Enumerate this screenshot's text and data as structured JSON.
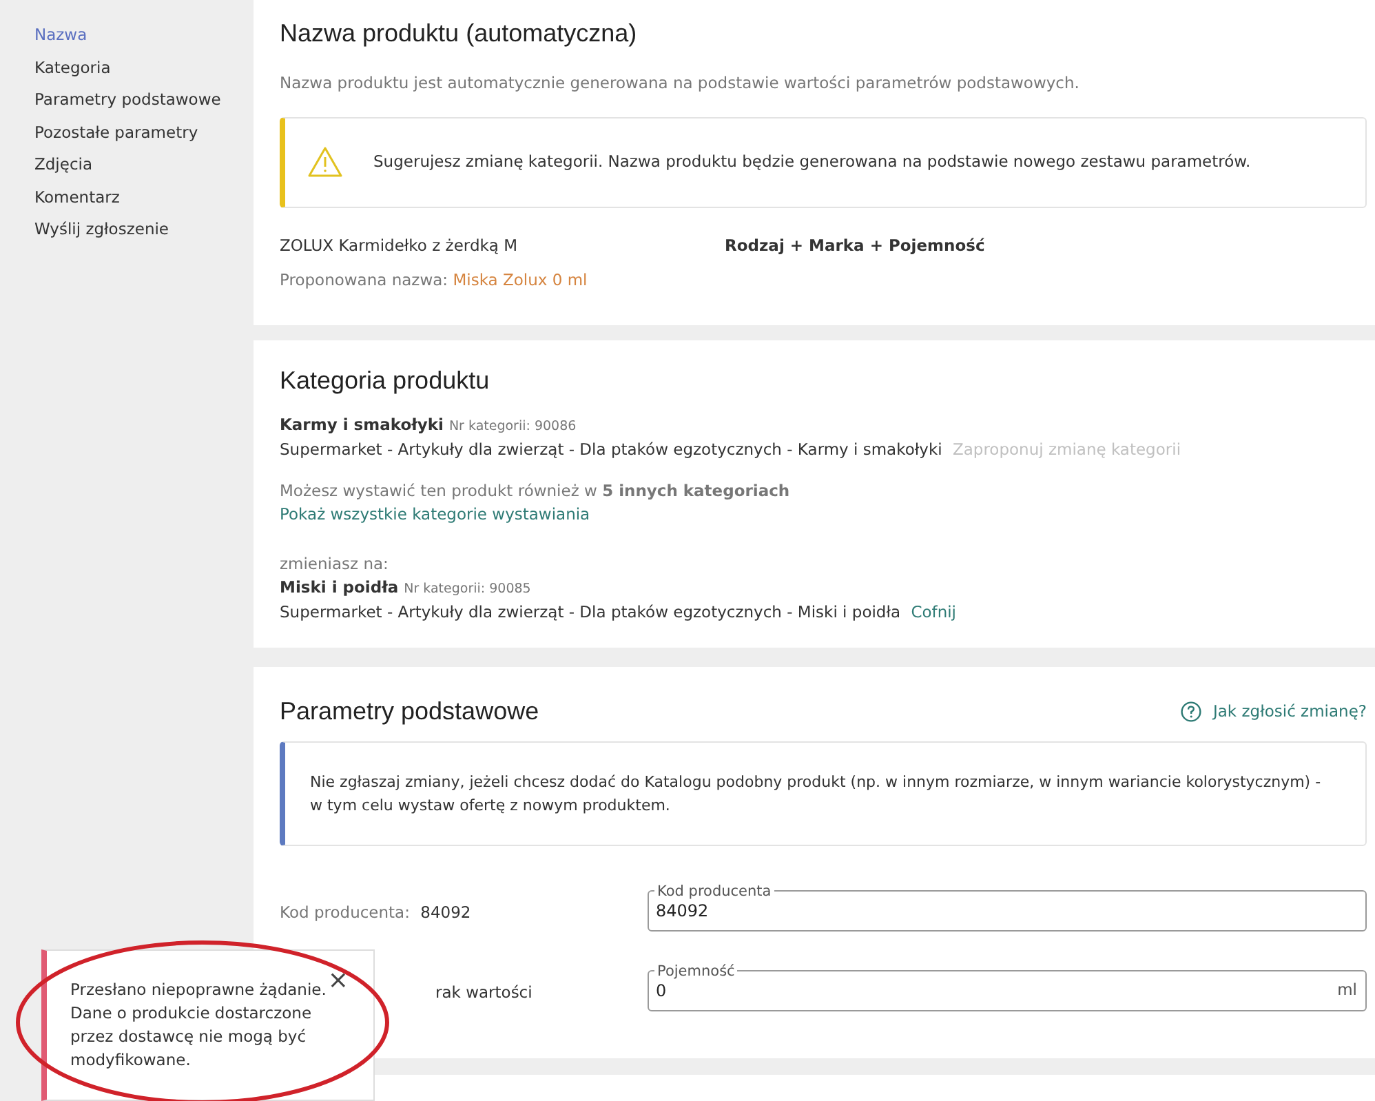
{
  "sidebar": {
    "items": [
      {
        "label": "Nazwa",
        "selected": true
      },
      {
        "label": "Kategoria",
        "selected": false
      },
      {
        "label": "Parametry podstawowe",
        "selected": false
      },
      {
        "label": "Pozostałe parametry",
        "selected": false
      },
      {
        "label": "Zdjęcia",
        "selected": false
      },
      {
        "label": "Komentarz",
        "selected": false
      },
      {
        "label": "Wyślij zgłoszenie",
        "selected": false
      }
    ]
  },
  "name_section": {
    "title": "Nazwa produktu (automatyczna)",
    "description": "Nazwa produktu jest automatycznie generowana na podstawie wartości parametrów podstawowych.",
    "alert": "Sugerujesz zmianę kategorii. Nazwa produktu będzie generowana na podstawie nowego zestawu parametrów.",
    "current_name": "ZOLUX Karmidełko z żerdką M",
    "formula": "Rodzaj + Marka + Pojemność",
    "proposed_label": "Proponowana nazwa:",
    "proposed_value": "Miska Zolux 0 ml"
  },
  "category_section": {
    "title": "Kategoria produktu",
    "current": {
      "name": "Karmy i smakołyki",
      "number": "Nr kategorii: 90086",
      "path": "Supermarket - Artykuły dla zwierząt - Dla ptaków egzotycznych - Karmy i smakołyki",
      "link": "Zaproponuj zmianę kategorii",
      "link_disabled": true
    },
    "more_text": "Możesz wystawić ten produkt również w **5 innych kategoriach**",
    "more_link": "Pokaż wszystkie kategorie wystawiania",
    "change_label": "zmieniasz na:",
    "changed": {
      "name": "Miski i poidła",
      "number": "Nr kategorii: 90085",
      "path": "Supermarket - Artykuły dla zwierząt - Dla ptaków egzotycznych - Miski i poidła",
      "link": "Cofnij",
      "link_disabled": false
    }
  },
  "basic_params": {
    "title": "Parametry podstawowe",
    "help_link": "Jak zgłosić zmianę?",
    "info": "Nie zgłaszaj zmiany, jeżeli chcesz dodać do Katalogu podobny produkt (np. w innym rozmiarze, w innym wariancie kolorystycznym) - w tym celu wystaw ofertę z nowym produktem.",
    "rows": [
      {
        "label": "Kod producenta:",
        "value": "84092",
        "field_label": "Kod producenta",
        "field_value": "84092"
      },
      {
        "label": "rak wartości",
        "field_label": "Pojemność",
        "field_value": "0",
        "suffix": "ml"
      }
    ]
  },
  "toast": {
    "message": "Przesłano niepoprawne żądanie. Dane o produkcie dostarczone przez dostawcę nie mogą być modyfikowane.",
    "close": "×"
  }
}
